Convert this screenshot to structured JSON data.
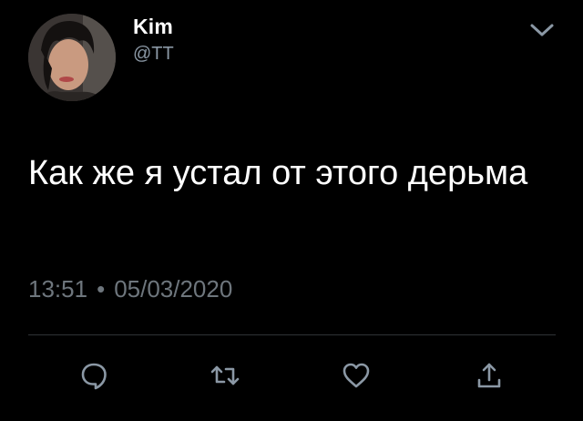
{
  "tweet": {
    "author": {
      "display_name": "Kim",
      "handle": "@TT",
      "avatar_icon": "profile-photo"
    },
    "text": "Как же я устал от этого дерьма",
    "time": "13:51",
    "separator": "•",
    "date": "05/03/2020",
    "actions": [
      {
        "name": "reply",
        "icon": "speech-bubble-icon"
      },
      {
        "name": "retweet",
        "icon": "retweet-arrows-icon"
      },
      {
        "name": "like",
        "icon": "heart-icon"
      },
      {
        "name": "share",
        "icon": "share-upload-icon"
      }
    ],
    "more_icon": "chevron-down-icon"
  },
  "colors": {
    "background": "#000000",
    "text_primary": "#ffffff",
    "text_secondary": "#8b98a5",
    "meta_text": "#6e767d",
    "divider": "#2f3336",
    "icon": "#8b98a5"
  }
}
